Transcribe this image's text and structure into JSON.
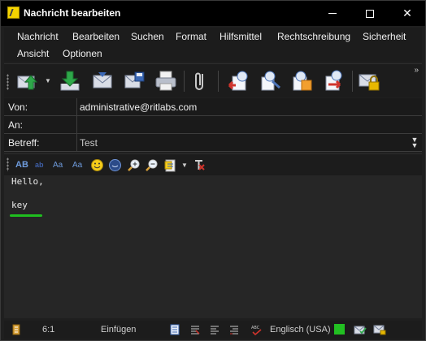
{
  "window": {
    "title": "Nachricht bearbeiten"
  },
  "menu": {
    "items": [
      "Nachricht",
      "Bearbeiten",
      "Suchen",
      "Format",
      "Hilfsmittel",
      "Rechtschreibung",
      "Sicherheit",
      "Ansicht",
      "Optionen"
    ]
  },
  "toolbar": {
    "icons": [
      "send-icon",
      "save-to-outbox-icon",
      "send-later-icon",
      "save-draft-icon",
      "print-icon",
      "attach-icon",
      "address-book-from-icon",
      "address-book-to-icon",
      "address-book-cc-icon",
      "address-book-bcc-icon",
      "encrypt-icon"
    ],
    "more": "»"
  },
  "header": {
    "from_label": "Von:",
    "from_value": "administrative@ritlabs.com",
    "to_label": "An:",
    "to_value": "",
    "subject_label": "Betreff:",
    "subject_value": "Test"
  },
  "format_toolbar": {
    "items": [
      "AB",
      "ab",
      "Aa",
      "Aa"
    ]
  },
  "editor": {
    "lines": [
      "Hello,",
      "",
      "key"
    ]
  },
  "status": {
    "position": "6:1",
    "mode": "Einfügen",
    "language": "Englisch (USA)"
  },
  "colors": {
    "accent_green": "#1fbf1f",
    "status_indicator": "#22c022"
  }
}
